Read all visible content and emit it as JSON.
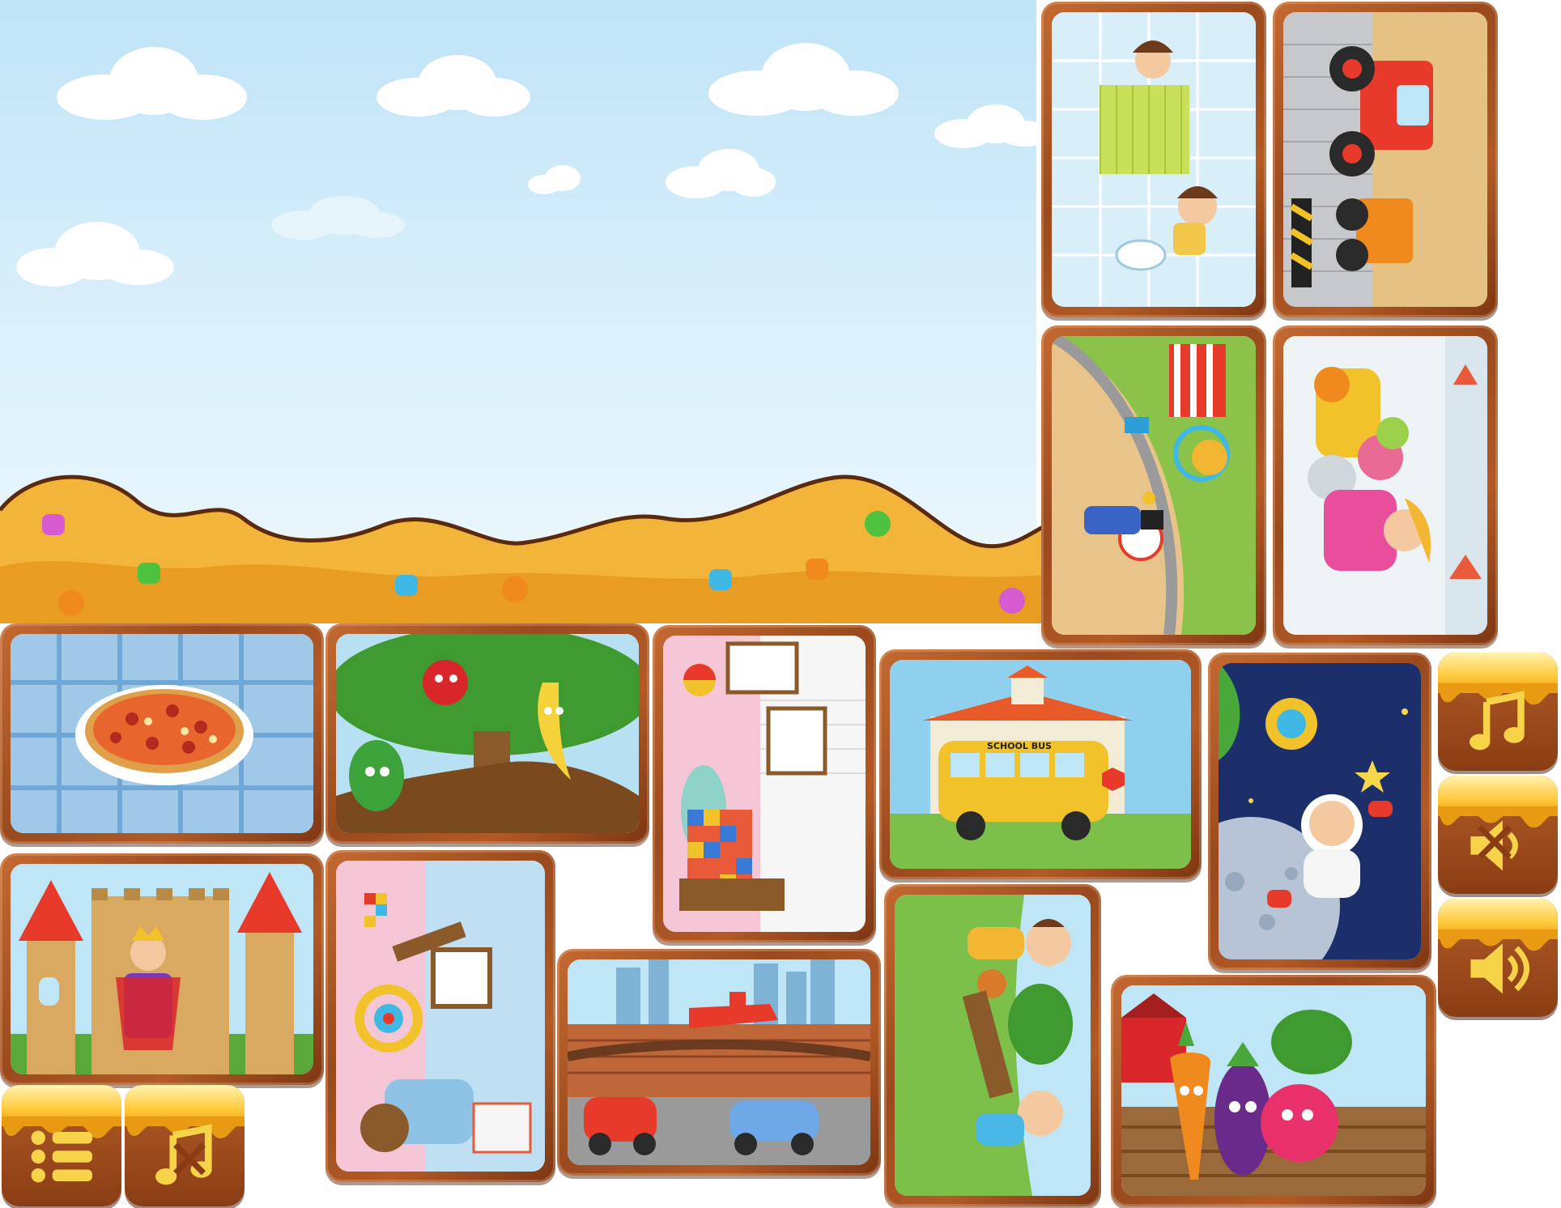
{
  "scene": {
    "sky_top": "#bfe3f7",
    "sky_bottom": "#eef8fd",
    "caramel_color": "#f3b43a",
    "candy_colors": [
      "#d65bd0",
      "#4cc23e",
      "#3fb8e6",
      "#f08a1e",
      "#e8412c",
      "#2bb3a8"
    ]
  },
  "puzzle_cards": [
    {
      "name": "bathroom-card",
      "subject": "bathroom"
    },
    {
      "name": "monster-truck-card",
      "subject": "monster-truck"
    },
    {
      "name": "circus-card",
      "subject": "circus"
    },
    {
      "name": "winter-kids-card",
      "subject": "winter"
    },
    {
      "name": "pizza-card",
      "subject": "pizza"
    },
    {
      "name": "fruit-tree-card",
      "subject": "fruit-tree"
    },
    {
      "name": "nursery-card",
      "subject": "nursery"
    },
    {
      "name": "school-bus-card",
      "subject": "school-bus",
      "label": "SCHOOL BUS"
    },
    {
      "name": "astronaut-card",
      "subject": "space"
    },
    {
      "name": "castle-card",
      "subject": "castle"
    },
    {
      "name": "kids-room-card",
      "subject": "kids-room"
    },
    {
      "name": "city-transport-card",
      "subject": "city-transport"
    },
    {
      "name": "playground-card",
      "subject": "playground"
    },
    {
      "name": "vegetables-card",
      "subject": "vegetables"
    }
  ],
  "buttons": {
    "music_icon": "music-note-icon",
    "sound_off_icon": "speaker-mute-icon",
    "sound_on_icon": "speaker-icon",
    "menu_icon": "menu-list-icon",
    "music_off_icon": "music-off-icon"
  }
}
